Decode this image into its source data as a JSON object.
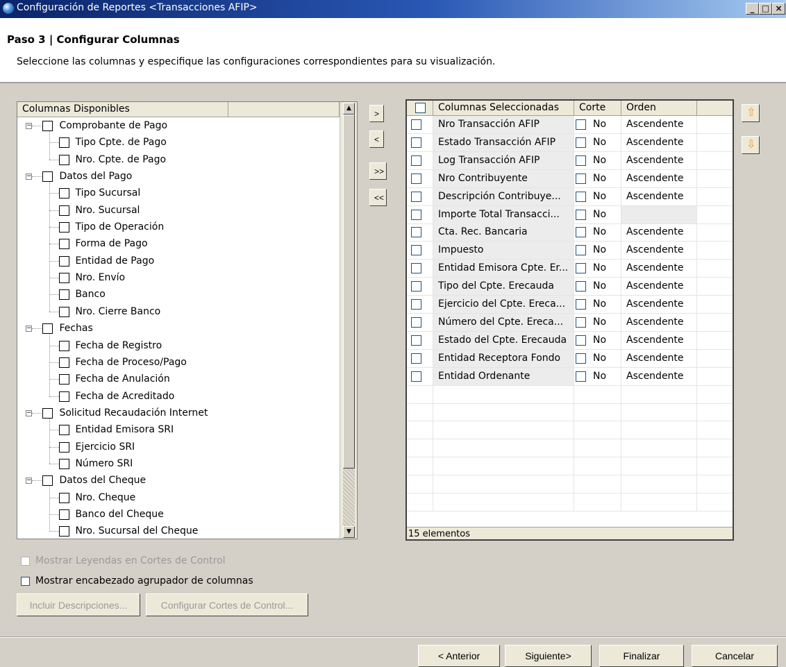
{
  "window": {
    "title": "Configuración de Reportes <Transacciones AFIP>",
    "min_label": "_",
    "max_label": "□",
    "close_label": "×"
  },
  "header": {
    "step_title": "Paso 3 | Configurar Columnas",
    "description": "Seleccione las columnas y especifique las configuraciones correspondientes para su visualización."
  },
  "available": {
    "header": "Columnas Disponibles",
    "groups": [
      {
        "label": "Comprobante de Pago",
        "items": [
          "Tipo Cpte. de Pago",
          "Nro. Cpte. de Pago"
        ]
      },
      {
        "label": "Datos del Pago",
        "items": [
          "Tipo Sucursal",
          "Nro. Sucursal",
          "Tipo de Operación",
          "Forma de Pago",
          "Entidad de Pago",
          "Nro. Envío",
          "Banco",
          "Nro. Cierre Banco"
        ]
      },
      {
        "label": "Fechas",
        "items": [
          "Fecha de Registro",
          "Fecha de Proceso/Pago",
          "Fecha de Anulación",
          "Fecha de Acreditado"
        ]
      },
      {
        "label": "Solicitud Recaudación Internet",
        "items": [
          "Entidad Emisora SRI",
          "Ejercicio SRI",
          "Número SRI"
        ]
      },
      {
        "label": "Datos del Cheque",
        "items": [
          "Nro. Cheque",
          "Banco del Cheque",
          "Nro. Sucursal del Cheque"
        ]
      }
    ]
  },
  "move_buttons": {
    "add": ">",
    "remove": "<",
    "add_all": ">>",
    "remove_all": "<<"
  },
  "selected": {
    "headers": {
      "name": "Columnas Seleccionadas",
      "cut": "Corte",
      "order": "Orden"
    },
    "rows": [
      {
        "name": "Nro Transacción AFIP",
        "cut": "No",
        "order": "Ascendente"
      },
      {
        "name": "Estado Transacción AFIP",
        "cut": "No",
        "order": "Ascendente"
      },
      {
        "name": "Log Transacción AFIP",
        "cut": "No",
        "order": "Ascendente"
      },
      {
        "name": "Nro Contribuyente",
        "cut": "No",
        "order": "Ascendente"
      },
      {
        "name": "Descripción Contribuye...",
        "cut": "No",
        "order": "Ascendente"
      },
      {
        "name": "Importe Total Transacci...",
        "cut": "No",
        "order": ""
      },
      {
        "name": "Cta. Rec. Bancaria",
        "cut": "No",
        "order": "Ascendente"
      },
      {
        "name": "Impuesto",
        "cut": "No",
        "order": "Ascendente"
      },
      {
        "name": "Entidad Emisora Cpte. Er...",
        "cut": "No",
        "order": "Ascendente"
      },
      {
        "name": "Tipo del Cpte. Erecauda",
        "cut": "No",
        "order": "Ascendente"
      },
      {
        "name": "Ejercicio del Cpte. Ereca...",
        "cut": "No",
        "order": "Ascendente"
      },
      {
        "name": "Número del Cpte. Ereca...",
        "cut": "No",
        "order": "Ascendente"
      },
      {
        "name": "Estado del Cpte. Erecauda",
        "cut": "No",
        "order": "Ascendente"
      },
      {
        "name": "Entidad Receptora Fondo",
        "cut": "No",
        "order": "Ascendente"
      },
      {
        "name": "Entidad Ordenante",
        "cut": "No",
        "order": "Ascendente"
      }
    ],
    "count_label": "15 elementos"
  },
  "options": {
    "show_legends": "Mostrar Leyendas en Cortes de Control",
    "show_grouping_header": "Mostrar encabezado agrupador de columnas",
    "include_descriptions": "Incluir Descripciones...",
    "configure_cuts": "Configurar Cortes de Control..."
  },
  "footer": {
    "previous": "< Anterior",
    "next": "Siguiente>",
    "finish": "Finalizar",
    "cancel": "Cancelar"
  },
  "colors": {
    "accent_up_down": "#e8a317",
    "titlebar": "#0a246a"
  }
}
